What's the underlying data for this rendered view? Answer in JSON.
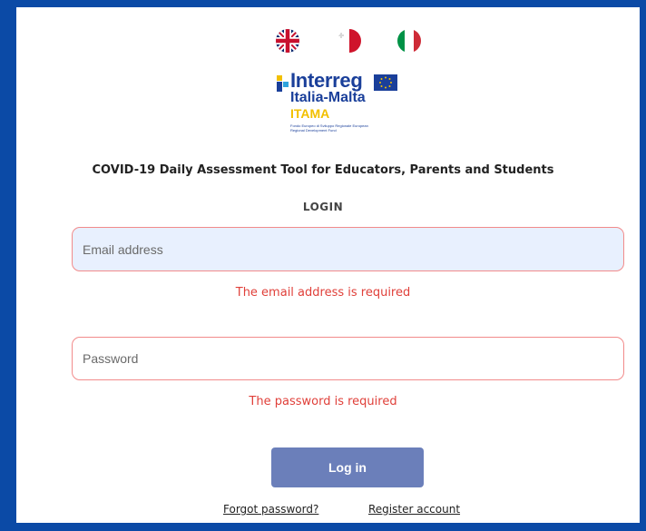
{
  "languages": [
    {
      "icon": "uk-flag-icon"
    },
    {
      "icon": "malta-flag-icon"
    },
    {
      "icon": "italy-flag-icon"
    }
  ],
  "logo": {
    "word": "Interreg",
    "sub": "Italia-Malta",
    "project": "ITAMA",
    "fine_print": "Fondo Europeo di Sviluppo Regionale European Regional Development Fund"
  },
  "page": {
    "title": "COVID-19 Daily Assessment Tool for Educators, Parents and Students",
    "heading": "LOGIN"
  },
  "form": {
    "email": {
      "placeholder": "Email address",
      "value": "",
      "error": "The email address is required"
    },
    "password": {
      "placeholder": "Password",
      "value": "",
      "error": "The password is required"
    },
    "submit_label": "Log in"
  },
  "links": {
    "forgot": "Forgot password?",
    "register": "Register account"
  },
  "colors": {
    "frame": "#0b4aa6",
    "error": "#e0403a",
    "button": "#6b7fba",
    "email_bg": "#e8f0fe"
  }
}
